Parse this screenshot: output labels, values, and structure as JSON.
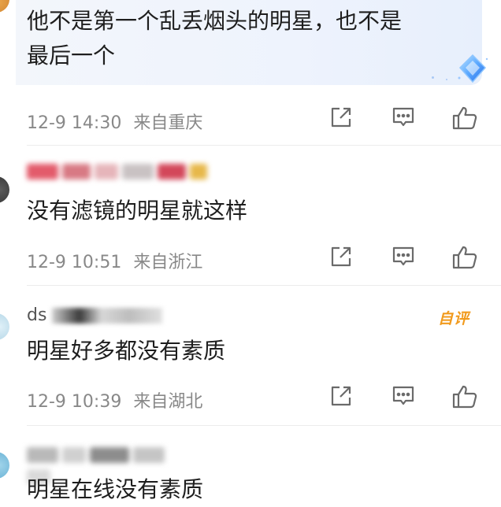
{
  "comments": [
    {
      "text_lines": [
        "他不是第一个乱丢烟头的明星，也不是",
        "最后一个"
      ],
      "date": "12-9 14:30",
      "location": "来自重庆"
    },
    {
      "username_partial": "",
      "text_lines": [
        "没有滤镜的明星就这样"
      ],
      "date": "12-9 10:51",
      "location": "来自浙江"
    },
    {
      "username_partial": "ds",
      "badge": "自评",
      "text_lines": [
        "明星好多都没有素质"
      ],
      "date": "12-9 10:39",
      "location": "来自湖北"
    },
    {
      "username_partial": "",
      "text_lines": [
        "明星在线没有素质"
      ]
    }
  ],
  "icons": {
    "share": "share-icon",
    "comment": "comment-icon",
    "like": "thumbs-up-icon",
    "gem": "diamond-badge-icon"
  },
  "colors": {
    "meta_text": "#888888",
    "badge": "#f19a1c",
    "icon": "#6a6a6a",
    "bubble": "#eef3fd"
  }
}
